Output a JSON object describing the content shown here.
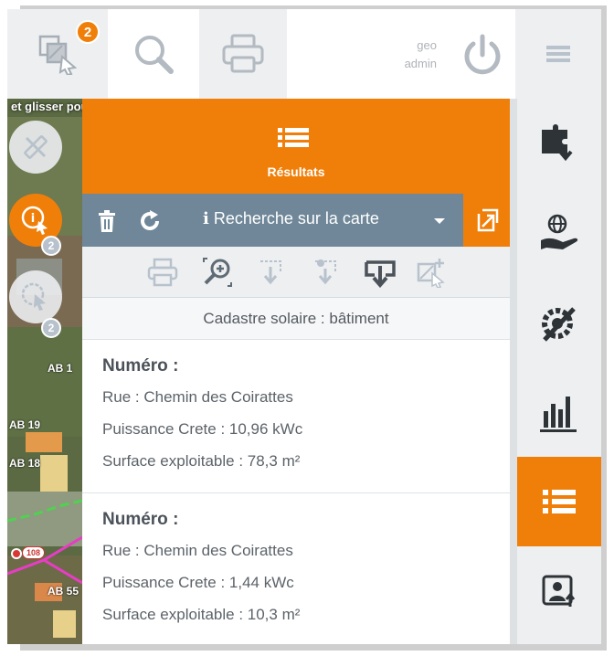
{
  "topbar": {
    "selection_badge": "2",
    "user": {
      "line1": "geo",
      "line2": "admin"
    },
    "icons": [
      "select-icon",
      "search-icon",
      "print-icon",
      "power-icon",
      "menu-icon"
    ]
  },
  "map": {
    "hint": "et glisser pour ajouter un cercle",
    "parcel_labels": [
      "AB 1",
      "AB 19",
      "AB 18",
      "AB 55"
    ],
    "point_label": "108",
    "tools": [
      {
        "name": "draw-tool",
        "count": ""
      },
      {
        "name": "info-tool",
        "count": "2"
      },
      {
        "name": "select-tool",
        "count": "2"
      }
    ]
  },
  "panel": {
    "title": "Résultats",
    "search_label": "Recherche sur la carte",
    "search_prefix": "i",
    "layer_name": "Cadastre solaire : bâtiment",
    "results": [
      {
        "title": "Numéro :",
        "rue": "Rue : Chemin des Coirattes",
        "puissance": "Puissance Crete : 10,96 kWc",
        "surface": "Surface exploitable : 78,3 m²"
      },
      {
        "title": "Numéro :",
        "rue": "Rue : Chemin des Coirattes",
        "puissance": "Puissance Crete : 1,44 kWc",
        "surface": "Surface exploitable : 10,3 m²"
      }
    ]
  },
  "sidebar": {
    "items": [
      "puzzle-download-icon",
      "globe-hand-icon",
      "gear-pencil-icon",
      "bar-chart-icon",
      "list-icon",
      "user-upload-icon"
    ],
    "active_index": 4
  },
  "colors": {
    "accent": "#f07f0a",
    "searchbar": "#6f8798",
    "muted": "#b8c2cc"
  }
}
